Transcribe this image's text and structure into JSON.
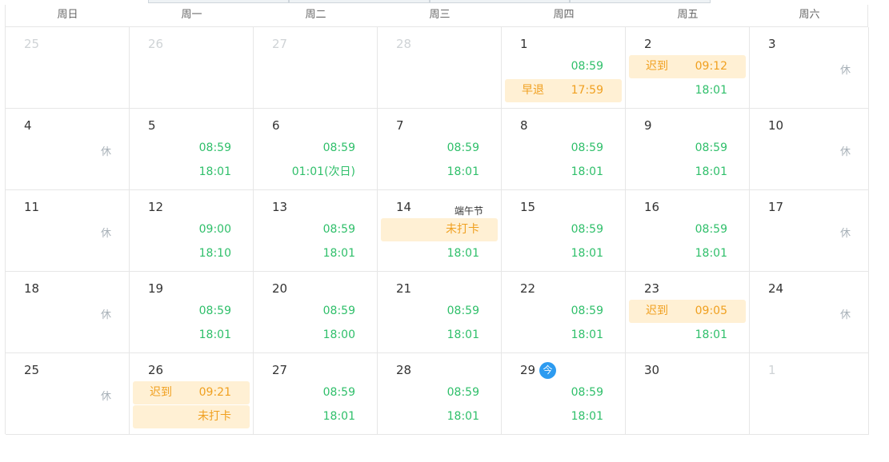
{
  "weekdays": [
    "周日",
    "周一",
    "周二",
    "周三",
    "周四",
    "周五",
    "周六"
  ],
  "colors": {
    "normal": "#2fbf6a",
    "warning_text": "#f0a020",
    "warning_bg": "#fff0d4",
    "today": "#2d9bf0",
    "rest": "#a8b1b8"
  },
  "weeks": [
    [
      {
        "day": "25",
        "other": true
      },
      {
        "day": "26",
        "other": true
      },
      {
        "day": "27",
        "other": true
      },
      {
        "day": "28",
        "other": true
      },
      {
        "day": "1",
        "e1": {
          "time": "08:59"
        },
        "e2": {
          "tag": "早退",
          "time": "17:59",
          "warn": true
        }
      },
      {
        "day": "2",
        "e1": {
          "tag": "迟到",
          "time": "09:12",
          "warn": true
        },
        "e2": {
          "time": "18:01"
        }
      },
      {
        "day": "3",
        "rest": "休"
      }
    ],
    [
      {
        "day": "4",
        "rest": "休"
      },
      {
        "day": "5",
        "e1": {
          "time": "08:59"
        },
        "e2": {
          "time": "18:01"
        }
      },
      {
        "day": "6",
        "e1": {
          "time": "08:59"
        },
        "e2": {
          "time": "01:01(次日)"
        }
      },
      {
        "day": "7",
        "e1": {
          "time": "08:59"
        },
        "e2": {
          "time": "18:01"
        }
      },
      {
        "day": "8",
        "e1": {
          "time": "08:59"
        },
        "e2": {
          "time": "18:01"
        }
      },
      {
        "day": "9",
        "e1": {
          "time": "08:59"
        },
        "e2": {
          "time": "18:01"
        }
      },
      {
        "day": "10",
        "rest": "休"
      }
    ],
    [
      {
        "day": "11",
        "rest": "休"
      },
      {
        "day": "12",
        "e1": {
          "time": "09:00"
        },
        "e2": {
          "time": "18:10"
        }
      },
      {
        "day": "13",
        "e1": {
          "time": "08:59"
        },
        "e2": {
          "time": "18:01"
        }
      },
      {
        "day": "14",
        "holiday": "端午节",
        "e1": {
          "time": "未打卡",
          "warn": true
        },
        "e2": {
          "time": "18:01"
        }
      },
      {
        "day": "15",
        "e1": {
          "time": "08:59"
        },
        "e2": {
          "time": "18:01"
        }
      },
      {
        "day": "16",
        "e1": {
          "time": "08:59"
        },
        "e2": {
          "time": "18:01"
        }
      },
      {
        "day": "17",
        "rest": "休"
      }
    ],
    [
      {
        "day": "18",
        "rest": "休"
      },
      {
        "day": "19",
        "e1": {
          "time": "08:59"
        },
        "e2": {
          "time": "18:01"
        }
      },
      {
        "day": "20",
        "e1": {
          "time": "08:59"
        },
        "e2": {
          "time": "18:00"
        }
      },
      {
        "day": "21",
        "e1": {
          "time": "08:59"
        },
        "e2": {
          "time": "18:01"
        }
      },
      {
        "day": "22",
        "e1": {
          "time": "08:59"
        },
        "e2": {
          "time": "18:01"
        }
      },
      {
        "day": "23",
        "e1": {
          "tag": "迟到",
          "time": "09:05",
          "warn": true
        },
        "e2": {
          "time": "18:01"
        }
      },
      {
        "day": "24",
        "rest": "休"
      }
    ],
    [
      {
        "day": "25",
        "rest": "休"
      },
      {
        "day": "26",
        "e1": {
          "tag": "迟到",
          "time": "09:21",
          "warn": true
        },
        "e2": {
          "time": "未打卡",
          "warn": true
        }
      },
      {
        "day": "27",
        "e1": {
          "time": "08:59"
        },
        "e2": {
          "time": "18:01"
        }
      },
      {
        "day": "28",
        "e1": {
          "time": "08:59"
        },
        "e2": {
          "time": "18:01"
        }
      },
      {
        "day": "29",
        "today": "今",
        "e1": {
          "time": "08:59"
        },
        "e2": {
          "time": "18:01"
        }
      },
      {
        "day": "30"
      },
      {
        "day": "1",
        "other": true
      }
    ]
  ]
}
